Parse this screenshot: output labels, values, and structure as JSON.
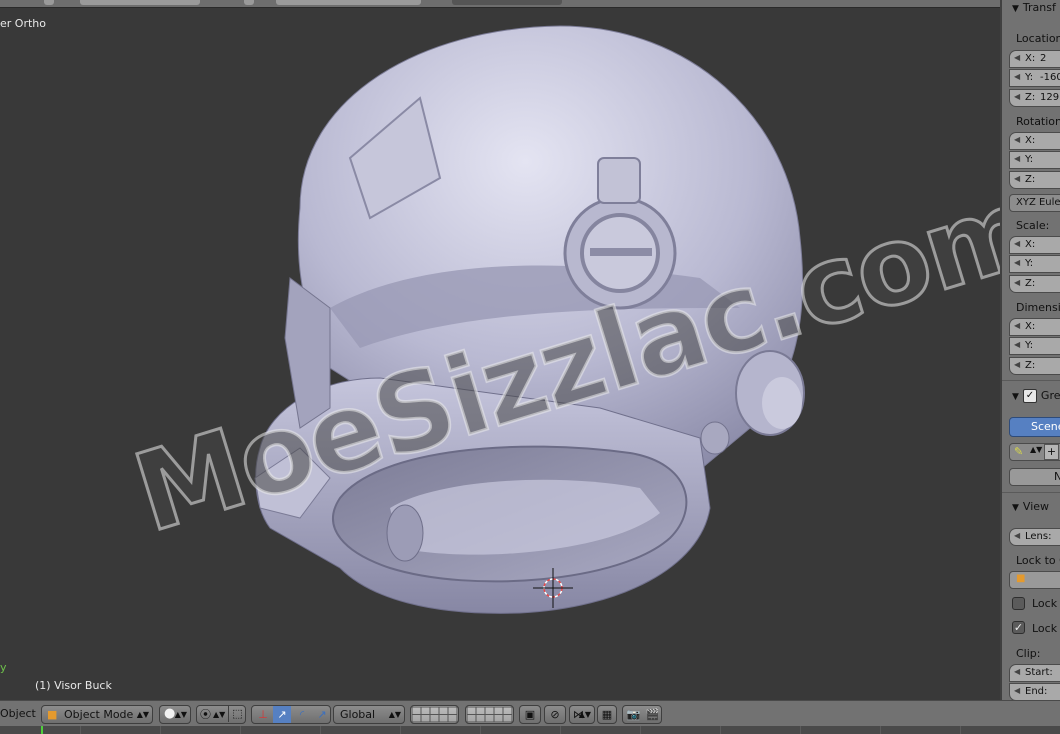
{
  "viewport": {
    "view_name": "User Ortho",
    "view_name_visible": "er Ortho",
    "object_info": "(1) Visor Buck",
    "axis_label": "y",
    "watermark": "MoeSizzlac.com"
  },
  "properties": {
    "transform_header": "Transf",
    "location_label": "Location:",
    "location": [
      {
        "axis": "X:",
        "value": "2"
      },
      {
        "axis": "Y:",
        "value": "-160"
      },
      {
        "axis": "Z:",
        "value": "129"
      }
    ],
    "rotation_label": "Rotation:",
    "rotation": [
      {
        "axis": "X:",
        "value": ""
      },
      {
        "axis": "Y:",
        "value": ""
      },
      {
        "axis": "Z:",
        "value": ""
      }
    ],
    "rotation_mode": "XYZ Eule",
    "scale_label": "Scale:",
    "scale": [
      {
        "axis": "X:",
        "value": ""
      },
      {
        "axis": "Y:",
        "value": ""
      },
      {
        "axis": "Z:",
        "value": ""
      }
    ],
    "dimensions_label": "Dimensio",
    "dimensions": [
      {
        "axis": "X:",
        "value": ""
      },
      {
        "axis": "Y:",
        "value": ""
      },
      {
        "axis": "Z:",
        "value": ""
      }
    ],
    "grease_header": "Gre",
    "scene_button": "Scene",
    "new_button": "N",
    "view_header": "View",
    "lens_label": "Lens:",
    "lock_to_label": "Lock to C",
    "lock_1": "Lock",
    "lock_2": "Lock",
    "clip_label": "Clip:",
    "clip_start": "Start:",
    "clip_end": "End:"
  },
  "bottom_bar": {
    "menu_object": "Object",
    "mode": "Object Mode",
    "transform_orientation": "Global"
  },
  "colors": {
    "viewport_bg": "#393939",
    "panel_bg": "#727272",
    "accent_blue": "#5680c2",
    "frame_marker": "#4fcf3c"
  }
}
